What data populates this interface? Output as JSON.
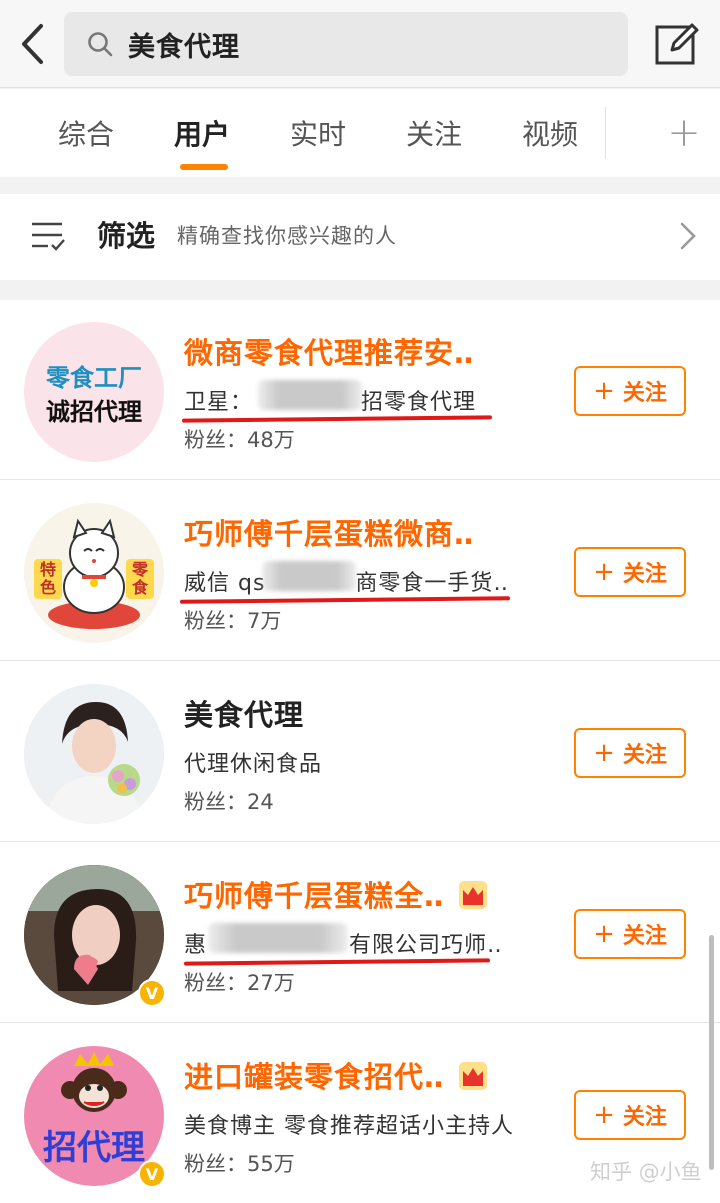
{
  "search": {
    "query": "美食代理"
  },
  "tabs": [
    {
      "label": "综合"
    },
    {
      "label": "用户",
      "active": true
    },
    {
      "label": "实时"
    },
    {
      "label": "关注"
    },
    {
      "label": "视频"
    }
  ],
  "tab_add_label": "+",
  "filter": {
    "title": "筛选",
    "subtitle": "精确查找你感兴趣的人"
  },
  "users": [
    {
      "name": "微商零食代理推荐安‥",
      "desc_prefix": "卫星：",
      "desc_suffix": "招零食代理",
      "fans": "粉丝：48万",
      "avatar_text_1": "零食工厂",
      "avatar_text_2": "诚招代理",
      "follow_label": "关注"
    },
    {
      "name": "巧师傅千层蛋糕微商‥",
      "desc_prefix": "威信 qs",
      "desc_suffix": "商零食一手货‥",
      "fans": "粉丝：7万",
      "avatar_side_left": "特色",
      "avatar_side_right": "零食",
      "follow_label": "关注"
    },
    {
      "name": "美食代理",
      "desc": "代理休闲食品",
      "fans": "粉丝：24",
      "follow_label": "关注"
    },
    {
      "name": "巧师傅千层蛋糕全‥",
      "desc_prefix": "惠",
      "desc_suffix": "有限公司巧师‥",
      "fans": "粉丝：27万",
      "verified": true,
      "follow_label": "关注"
    },
    {
      "name": "进口罐装零食招代‥",
      "desc": "美食博主 零食推荐超话小主持人",
      "fans": "粉丝：55万",
      "avatar_text": "招代理",
      "verified": true,
      "follow_label": "关注"
    }
  ],
  "watermark": "知乎 @小鱼",
  "colors": {
    "accent": "#ff8200",
    "name_highlight": "#ff6600",
    "annotation_line": "#e01818",
    "verified_badge": "#f8b400"
  }
}
